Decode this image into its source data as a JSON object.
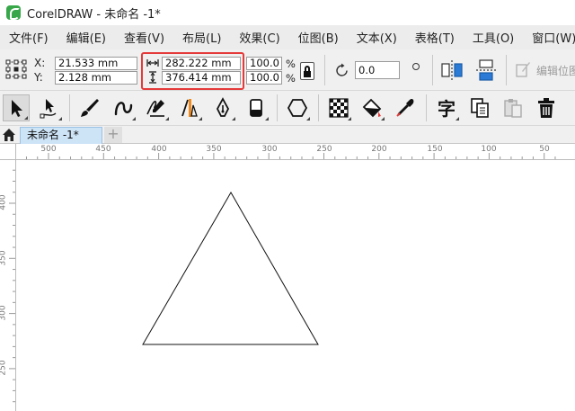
{
  "window": {
    "title": "CorelDRAW - 未命名 -1*"
  },
  "menu": [
    "文件(F)",
    "编辑(E)",
    "查看(V)",
    "布局(L)",
    "效果(C)",
    "位图(B)",
    "文本(X)",
    "表格(T)",
    "工具(O)",
    "窗口(W)"
  ],
  "property_bar": {
    "x_label": "X:",
    "y_label": "Y:",
    "x_value": "21.533 mm",
    "y_value": "2.128 mm",
    "width_value": "282.222 mm",
    "height_value": "376.414 mm",
    "scale_x": "100.0",
    "scale_y": "100.0",
    "pct_symbol": "%",
    "rotation_value": "0.0",
    "edit_label": "编辑位图"
  },
  "document_tab": {
    "label": "未命名 -1*",
    "add_label": "+"
  },
  "ruler": {
    "horizontal_labels": [
      "500",
      "450",
      "400",
      "350",
      "300",
      "250",
      "200",
      "150",
      "100",
      "50"
    ],
    "vertical_labels": [
      "400",
      "350",
      "300",
      "250"
    ]
  },
  "colors": {
    "highlight": "#e53a3a",
    "tab_active": "#cde3f6",
    "accent_blue": "#2b7bd6"
  }
}
